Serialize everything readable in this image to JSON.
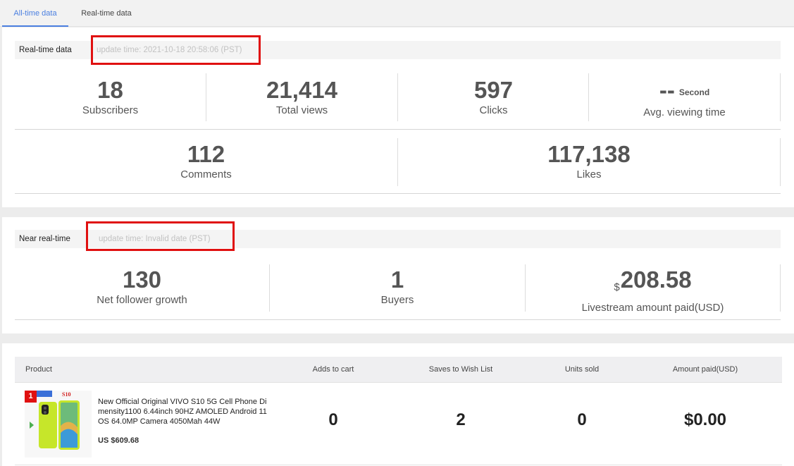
{
  "tabs": [
    {
      "label": "All-time data",
      "active": true
    },
    {
      "label": "Real-time data",
      "active": false
    }
  ],
  "realtime": {
    "title": "Real-time data",
    "update_time": "update time: 2021-10-18 20:58:06 (PST)",
    "subscribers": {
      "value": "18",
      "label": "Subscribers"
    },
    "total_views": {
      "value": "21,414",
      "label": "Total views"
    },
    "clicks": {
      "value": "597",
      "label": "Clicks"
    },
    "avg_viewing_time": {
      "value": "--",
      "unit": "Second",
      "label": "Avg. viewing time"
    },
    "comments": {
      "value": "112",
      "label": "Comments"
    },
    "likes": {
      "value": "117,138",
      "label": "Likes"
    }
  },
  "near_realtime": {
    "title": "Near real-time",
    "update_time": "update time: Invalid date (PST)",
    "net_follower_growth": {
      "value": "130",
      "label": "Net follower growth"
    },
    "buyers": {
      "value": "1",
      "label": "Buyers"
    },
    "livestream_amount": {
      "currency": "$",
      "value": "208.58",
      "label": "Livestream amount paid(USD)"
    }
  },
  "products": {
    "headers": {
      "product": "Product",
      "adds_to_cart": "Adds to cart",
      "saves_to_wishlist": "Saves to Wish List",
      "units_sold": "Units sold",
      "amount_paid": "Amount paid(USD)"
    },
    "rows": [
      {
        "rank": "1",
        "thumb_tag": "S10",
        "name": "New Official Original VIVO S10 5G Cell Phone Dimensity1100 6.44inch 90HZ AMOLED Android 11 OS 64.0MP Camera 4050Mah 44W",
        "price": "US $609.68",
        "adds_to_cart": "0",
        "saves_to_wishlist": "2",
        "units_sold": "0",
        "amount_paid": "$0.00"
      }
    ]
  },
  "colors": {
    "accent": "#4a7fe0",
    "highlight_box": "#e01010",
    "phone_body": "#c6e62a"
  },
  "icons": {
    "play_store": "play-store-icon"
  }
}
